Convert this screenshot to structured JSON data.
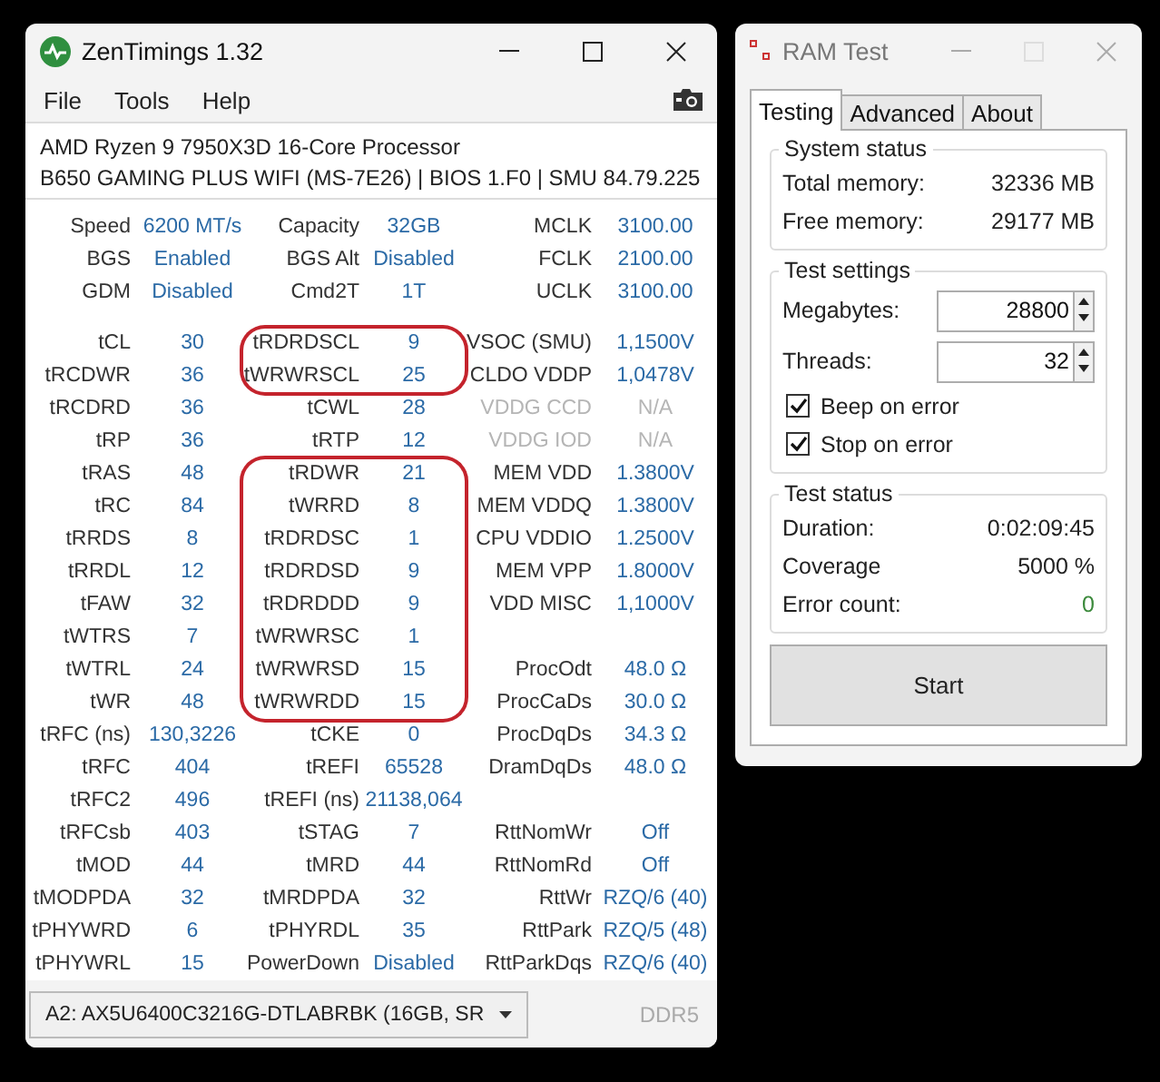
{
  "zentimings": {
    "title": "ZenTimings 1.32",
    "menu": [
      "File",
      "Tools",
      "Help"
    ],
    "cpu": "AMD Ryzen 9 7950X3D 16-Core Processor",
    "board": "B650 GAMING PLUS WIFI (MS-7E26) | BIOS 1.F0 | SMU 84.79.225",
    "summary_rows": [
      {
        "left": {
          "label": "Speed",
          "value": "6200 MT/s"
        },
        "middle": {
          "label": "Capacity",
          "value": "32GB"
        },
        "right": {
          "label": "MCLK",
          "value": "3100.00"
        }
      },
      {
        "left": {
          "label": "BGS",
          "value": "Enabled"
        },
        "middle": {
          "label": "BGS Alt",
          "value": "Disabled"
        },
        "right": {
          "label": "FCLK",
          "value": "2100.00"
        }
      },
      {
        "left": {
          "label": "GDM",
          "value": "Disabled"
        },
        "middle": {
          "label": "Cmd2T",
          "value": "1T"
        },
        "right": {
          "label": "UCLK",
          "value": "3100.00"
        }
      }
    ],
    "timing_rows": [
      {
        "left": {
          "label": "tCL",
          "value": "30"
        },
        "middle": {
          "label": "tRDRDSCL",
          "value": "9",
          "circled": true
        },
        "right": {
          "label": "VSOC (SMU)",
          "value": "1,1500V",
          "disabled": false
        }
      },
      {
        "left": {
          "label": "tRCDWR",
          "value": "36"
        },
        "middle": {
          "label": "tWRWRSCL",
          "value": "25",
          "circled": true
        },
        "right": {
          "label": "CLDO VDDP",
          "value": "1,0478V",
          "disabled": false
        }
      },
      {
        "left": {
          "label": "tRCDRD",
          "value": "36"
        },
        "middle": {
          "label": "tCWL",
          "value": "28",
          "circled": false
        },
        "right": {
          "label": "VDDG CCD",
          "value": "N/A",
          "disabled": true
        }
      },
      {
        "left": {
          "label": "tRP",
          "value": "36"
        },
        "middle": {
          "label": "tRTP",
          "value": "12",
          "circled": false
        },
        "right": {
          "label": "VDDG IOD",
          "value": "N/A",
          "disabled": true
        }
      },
      {
        "left": {
          "label": "tRAS",
          "value": "48"
        },
        "middle": {
          "label": "tRDWR",
          "value": "21",
          "circled": true
        },
        "right": {
          "label": "MEM VDD",
          "value": "1.3800V",
          "disabled": false
        }
      },
      {
        "left": {
          "label": "tRC",
          "value": "84"
        },
        "middle": {
          "label": "tWRRD",
          "value": "8",
          "circled": true
        },
        "right": {
          "label": "MEM VDDQ",
          "value": "1.3800V",
          "disabled": false
        }
      },
      {
        "left": {
          "label": "tRRDS",
          "value": "8"
        },
        "middle": {
          "label": "tRDRDSC",
          "value": "1",
          "circled": true
        },
        "right": {
          "label": "CPU VDDIO",
          "value": "1.2500V",
          "disabled": false
        }
      },
      {
        "left": {
          "label": "tRRDL",
          "value": "12"
        },
        "middle": {
          "label": "tRDRDSD",
          "value": "9",
          "circled": true
        },
        "right": {
          "label": "MEM VPP",
          "value": "1.8000V",
          "disabled": false
        }
      },
      {
        "left": {
          "label": "tFAW",
          "value": "32"
        },
        "middle": {
          "label": "tRDRDDD",
          "value": "9",
          "circled": true
        },
        "right": {
          "label": "VDD MISC",
          "value": "1,1000V",
          "disabled": false
        }
      },
      {
        "left": {
          "label": "tWTRS",
          "value": "7"
        },
        "middle": {
          "label": "tWRWRSC",
          "value": "1",
          "circled": true
        }
      },
      {
        "left": {
          "label": "tWTRL",
          "value": "24"
        },
        "middle": {
          "label": "tWRWRSD",
          "value": "15",
          "circled": true
        },
        "right": {
          "label": "ProcOdt",
          "value": "48.0 Ω",
          "disabled": false
        }
      },
      {
        "left": {
          "label": "tWR",
          "value": "48"
        },
        "middle": {
          "label": "tWRWRDD",
          "value": "15",
          "circled": true
        },
        "right": {
          "label": "ProcCaDs",
          "value": "30.0 Ω",
          "disabled": false
        }
      },
      {
        "left": {
          "label": "tRFC (ns)",
          "value": "130,3226"
        },
        "middle": {
          "label": "tCKE",
          "value": "0",
          "circled": false
        },
        "right": {
          "label": "ProcDqDs",
          "value": "34.3 Ω",
          "disabled": false
        }
      },
      {
        "left": {
          "label": "tRFC",
          "value": "404"
        },
        "middle": {
          "label": "tREFI",
          "value": "65528",
          "circled": false
        },
        "right": {
          "label": "DramDqDs",
          "value": "48.0 Ω",
          "disabled": false
        }
      },
      {
        "left": {
          "label": "tRFC2",
          "value": "496"
        },
        "middle": {
          "label": "tREFI (ns)",
          "value": "21138,064",
          "circled": false
        }
      },
      {
        "left": {
          "label": "tRFCsb",
          "value": "403"
        },
        "middle": {
          "label": "tSTAG",
          "value": "7",
          "circled": false
        },
        "right": {
          "label": "RttNomWr",
          "value": "Off",
          "disabled": false
        }
      },
      {
        "left": {
          "label": "tMOD",
          "value": "44"
        },
        "middle": {
          "label": "tMRD",
          "value": "44",
          "circled": false
        },
        "right": {
          "label": "RttNomRd",
          "value": "Off",
          "disabled": false
        }
      },
      {
        "left": {
          "label": "tMODPDA",
          "value": "32"
        },
        "middle": {
          "label": "tMRDPDA",
          "value": "32",
          "circled": false
        },
        "right": {
          "label": "RttWr",
          "value": "RZQ/6 (40)",
          "disabled": false
        }
      },
      {
        "left": {
          "label": "tPHYWRD",
          "value": "6"
        },
        "middle": {
          "label": "tPHYRDL",
          "value": "35",
          "circled": false
        },
        "right": {
          "label": "RttPark",
          "value": "RZQ/5 (48)",
          "disabled": false
        }
      },
      {
        "left": {
          "label": "tPHYWRL",
          "value": "15"
        },
        "middle": {
          "label": "PowerDown",
          "value": "Disabled",
          "circled": false
        },
        "right": {
          "label": "RttParkDqs",
          "value": "RZQ/6 (40)",
          "disabled": false
        }
      }
    ],
    "module_select": "A2: AX5U6400C3216G-DTLABRBK (16GB, SR",
    "memory_type": "DDR5"
  },
  "ram_test": {
    "title": "RAM Test",
    "tabs": [
      {
        "label": "Testing",
        "selected": true
      },
      {
        "label": "Advanced",
        "selected": false
      },
      {
        "label": "About",
        "selected": false
      }
    ],
    "system_status": {
      "title": "System status",
      "items": [
        {
          "label": "Total memory:",
          "value": "32336 MB"
        },
        {
          "label": "Free memory:",
          "value": "29177 MB"
        }
      ]
    },
    "test_settings": {
      "title": "Test settings",
      "fields": [
        {
          "label": "Megabytes:",
          "value": "28800"
        },
        {
          "label": "Threads:",
          "value": "32"
        }
      ],
      "checkboxes": [
        {
          "label": "Beep on error",
          "checked": true
        },
        {
          "label": "Stop on error",
          "checked": true
        }
      ]
    },
    "test_status": {
      "title": "Test status",
      "items": [
        {
          "label": "Duration:",
          "value": "0:02:09:45"
        },
        {
          "label": "Coverage",
          "value": "5000 %"
        },
        {
          "label": "Error count:",
          "value": "0",
          "color": "#3c8a3c"
        }
      ]
    },
    "start_button": "Start"
  }
}
